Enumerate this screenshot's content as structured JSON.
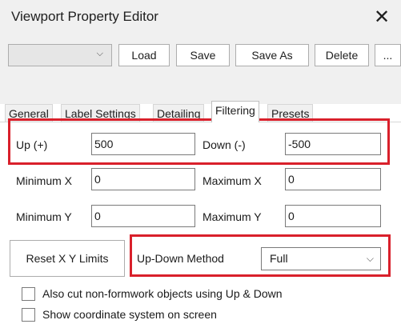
{
  "window": {
    "title": "Viewport Property Editor",
    "close_glyph": "✕"
  },
  "toolbar": {
    "combo_chevron": "⌵",
    "buttons": {
      "load": "Load",
      "save": "Save",
      "save_as": "Save As",
      "delete": "Delete",
      "more": "..."
    }
  },
  "tabs": [
    {
      "label": "General"
    },
    {
      "label": "Label Settings"
    },
    {
      "label": "Detailing"
    },
    {
      "label": "Filtering",
      "active": true
    },
    {
      "label": "Presets"
    }
  ],
  "filtering": {
    "up_label": "Up (+)",
    "up_value": "500",
    "down_label": "Down (-)",
    "down_value": "-500",
    "min_x_label": "Minimum X",
    "min_x_value": "0",
    "max_x_label": "Maximum X",
    "max_x_value": "0",
    "min_y_label": "Minimum Y",
    "min_y_value": "0",
    "max_y_label": "Maximum Y",
    "max_y_value": "0",
    "reset_label": "Reset X Y Limits",
    "method_label": "Up-Down Method",
    "method_value": "Full",
    "method_chevron": "⌵",
    "cut_label": "Also cut non-formwork objects using Up & Down",
    "cut_checked": false,
    "coord_label": "Show coordinate system on screen",
    "coord_checked": false
  },
  "highlight_color": "#d9202b"
}
